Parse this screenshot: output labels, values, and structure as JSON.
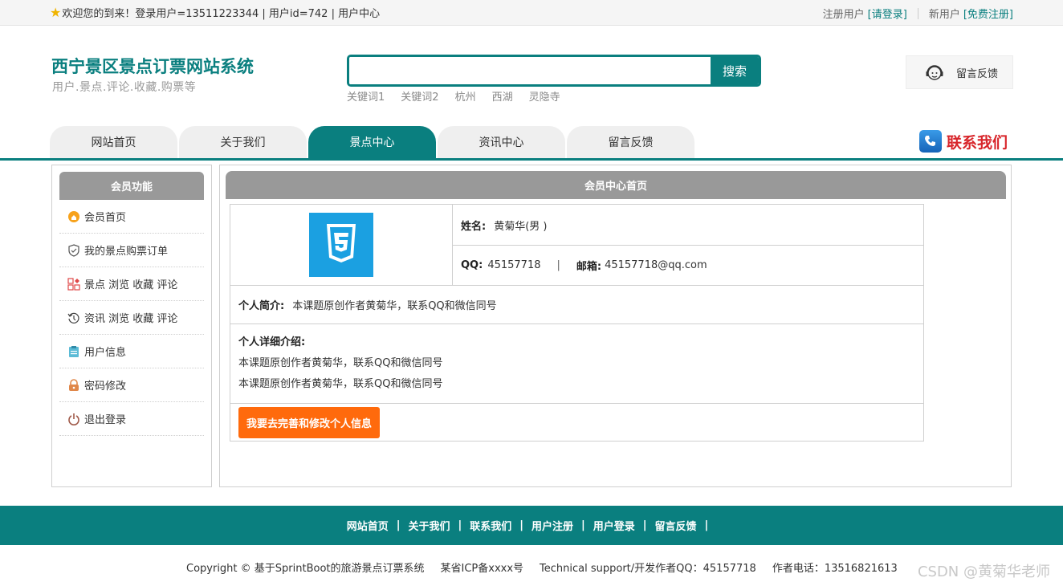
{
  "topbar": {
    "welcome": "欢迎您的到来！登录用户=13511223344 | 用户id=742 | 用户中心",
    "register_label": "注册用户",
    "login_link": "[请登录]",
    "newuser_label": "新用户",
    "signup_link": "[免费注册]"
  },
  "brand": {
    "title": "西宁景区景点订票网站系统",
    "subtitle": "用户.景点.评论.收藏.购票等"
  },
  "search": {
    "value": "",
    "button": "搜索",
    "keywords": [
      "关键词1",
      "关键词2",
      "杭州",
      "西湖",
      "灵隐寺"
    ]
  },
  "feedback_box": {
    "label": "留言反馈"
  },
  "nav": {
    "tabs": [
      {
        "label": "网站首页"
      },
      {
        "label": "关于我们"
      },
      {
        "label": "景点中心"
      },
      {
        "label": "资讯中心"
      },
      {
        "label": "留言反馈"
      }
    ],
    "active_index": 2,
    "contact": "联系我们"
  },
  "sidebar": {
    "title": "会员功能",
    "items": [
      {
        "label": "会员首页",
        "icon": "home-icon"
      },
      {
        "label": "我的景点购票订单",
        "icon": "shield-icon"
      },
      {
        "label": "景点 浏览 收藏 评论",
        "icon": "grid-icon"
      },
      {
        "label": "资讯 浏览 收藏 评论",
        "icon": "history-icon"
      },
      {
        "label": "用户信息",
        "icon": "clipboard-icon"
      },
      {
        "label": "密码修改",
        "icon": "lock-icon"
      },
      {
        "label": "退出登录",
        "icon": "power-icon"
      }
    ]
  },
  "main": {
    "title": "会员中心首页",
    "profile": {
      "name_label": "姓名:",
      "name_value": "黄菊华(男 )",
      "qq_label": "QQ:",
      "qq_value": "45157718",
      "sep": "|",
      "email_label": "邮箱:",
      "email_value": "45157718@qq.com",
      "intro_label": "个人简介:",
      "intro_value": "本课题原创作者黄菊华，联系QQ和微信同号",
      "detail_title": "个人详细介绍:",
      "detail_lines": [
        "本课题原创作者黄菊华，联系QQ和微信同号",
        "本课题原创作者黄菊华，联系QQ和微信同号"
      ],
      "edit_button": "我要去完善和修改个人信息"
    }
  },
  "footer": {
    "links": [
      "网站首页",
      "关于我们",
      "联系我们",
      "用户注册",
      "用户登录",
      "留言反馈"
    ],
    "pipe": "|",
    "copyright": "Copyright © 基于SprintBoot的旅游景点订票系统",
    "icp": "某省ICP备xxxx号",
    "support": "Technical support/开发作者QQ：45157718",
    "phone": "作者电话：13516821613",
    "watermark": "CSDN @黄菊华老师"
  },
  "colors": {
    "brand": "#0a7f7f",
    "header_gray": "#999999",
    "button_orange": "#ff6a0c",
    "contact_red": "#d8262b"
  }
}
